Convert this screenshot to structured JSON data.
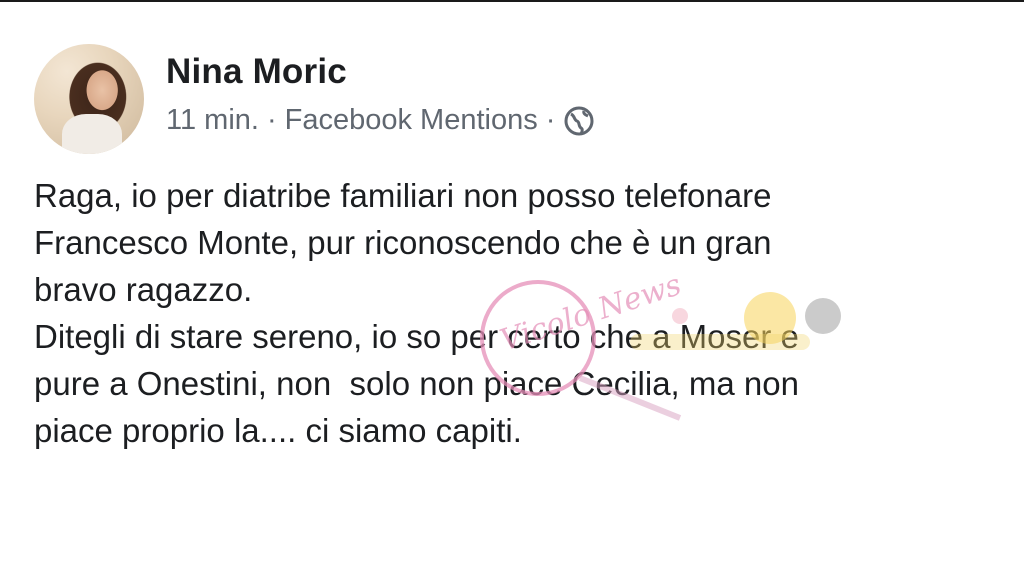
{
  "post": {
    "author": "Nina Moric",
    "time": "11 min.",
    "separator": "·",
    "source": "Facebook Mentions",
    "audience_icon": "globe-icon",
    "lines": [
      "Raga, io per diatribe familiari non posso telefonare",
      "Francesco Monte, pur riconoscendo che è un gran",
      "bravo ragazzo.",
      "Ditegli di stare sereno, io so per certo che a Moser e",
      "pure a Onestini, non  solo non piace Cecilia, ma non",
      "piace proprio la.... ci siamo capiti."
    ]
  },
  "watermark": {
    "text": "Vicolo News"
  },
  "colors": {
    "text": "#1c1e21",
    "meta": "#606770",
    "watermark": "#e58fb8"
  }
}
